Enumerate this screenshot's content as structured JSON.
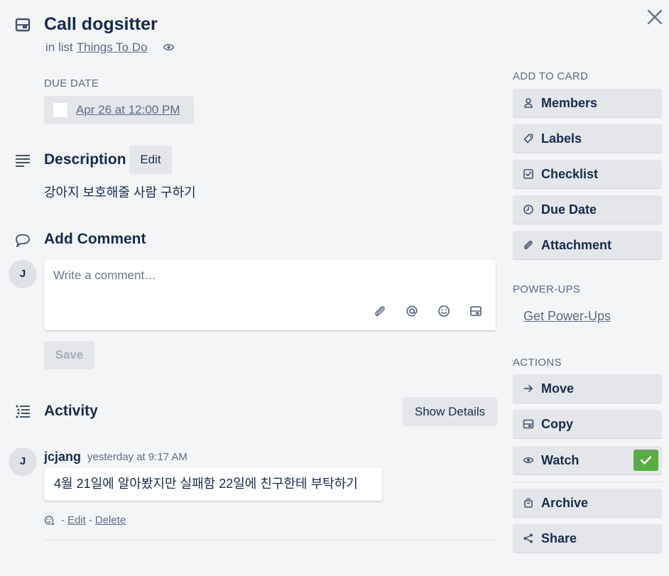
{
  "card": {
    "title": "Call dogsitter",
    "in_list_prefix": "in list",
    "list_name": "Things To Do"
  },
  "due": {
    "label": "DUE DATE",
    "value": "Apr 26 at 12:00 PM"
  },
  "description": {
    "heading": "Description",
    "edit_label": "Edit",
    "text": "강아지 보호해줄 사람 구하기"
  },
  "comment": {
    "heading": "Add Comment",
    "avatar_initial": "J",
    "placeholder": "Write a comment…",
    "save_label": "Save",
    "tools": [
      "paperclip-icon",
      "at-sign-icon",
      "emoji-icon",
      "card-icon"
    ]
  },
  "activity": {
    "heading": "Activity",
    "show_details_label": "Show Details",
    "items": [
      {
        "avatar_initial": "J",
        "user": "jcjang",
        "time": "yesterday at 9:17 AM",
        "text": "4월 21일에 알아봤지만 실패함 22일에 친구한테 부탁하기",
        "edit_label": "Edit",
        "delete_label": "Delete"
      }
    ]
  },
  "sidebar": {
    "add_to_card_label": "ADD TO CARD",
    "add_to_card": [
      {
        "label": "Members",
        "icon": "person-icon"
      },
      {
        "label": "Labels",
        "icon": "tag-icon"
      },
      {
        "label": "Checklist",
        "icon": "checklist-icon"
      },
      {
        "label": "Due Date",
        "icon": "clock-icon"
      },
      {
        "label": "Attachment",
        "icon": "paperclip-icon"
      }
    ],
    "powerups_label": "POWER-UPS",
    "get_powerups_label": "Get Power-Ups",
    "actions_label": "ACTIONS",
    "actions": [
      {
        "label": "Move",
        "icon": "arrow-right-icon"
      },
      {
        "label": "Copy",
        "icon": "card-icon"
      },
      {
        "label": "Watch",
        "icon": "eye-icon",
        "checked": true
      },
      {
        "label": "Archive",
        "icon": "archive-icon"
      },
      {
        "label": "Share",
        "icon": "share-icon"
      }
    ]
  },
  "colors": {
    "background": "#f4f5f7",
    "button": "#e4e6ea",
    "text": "#172b4d",
    "muted": "#5e6c84",
    "watch_check": "#5aac44"
  }
}
